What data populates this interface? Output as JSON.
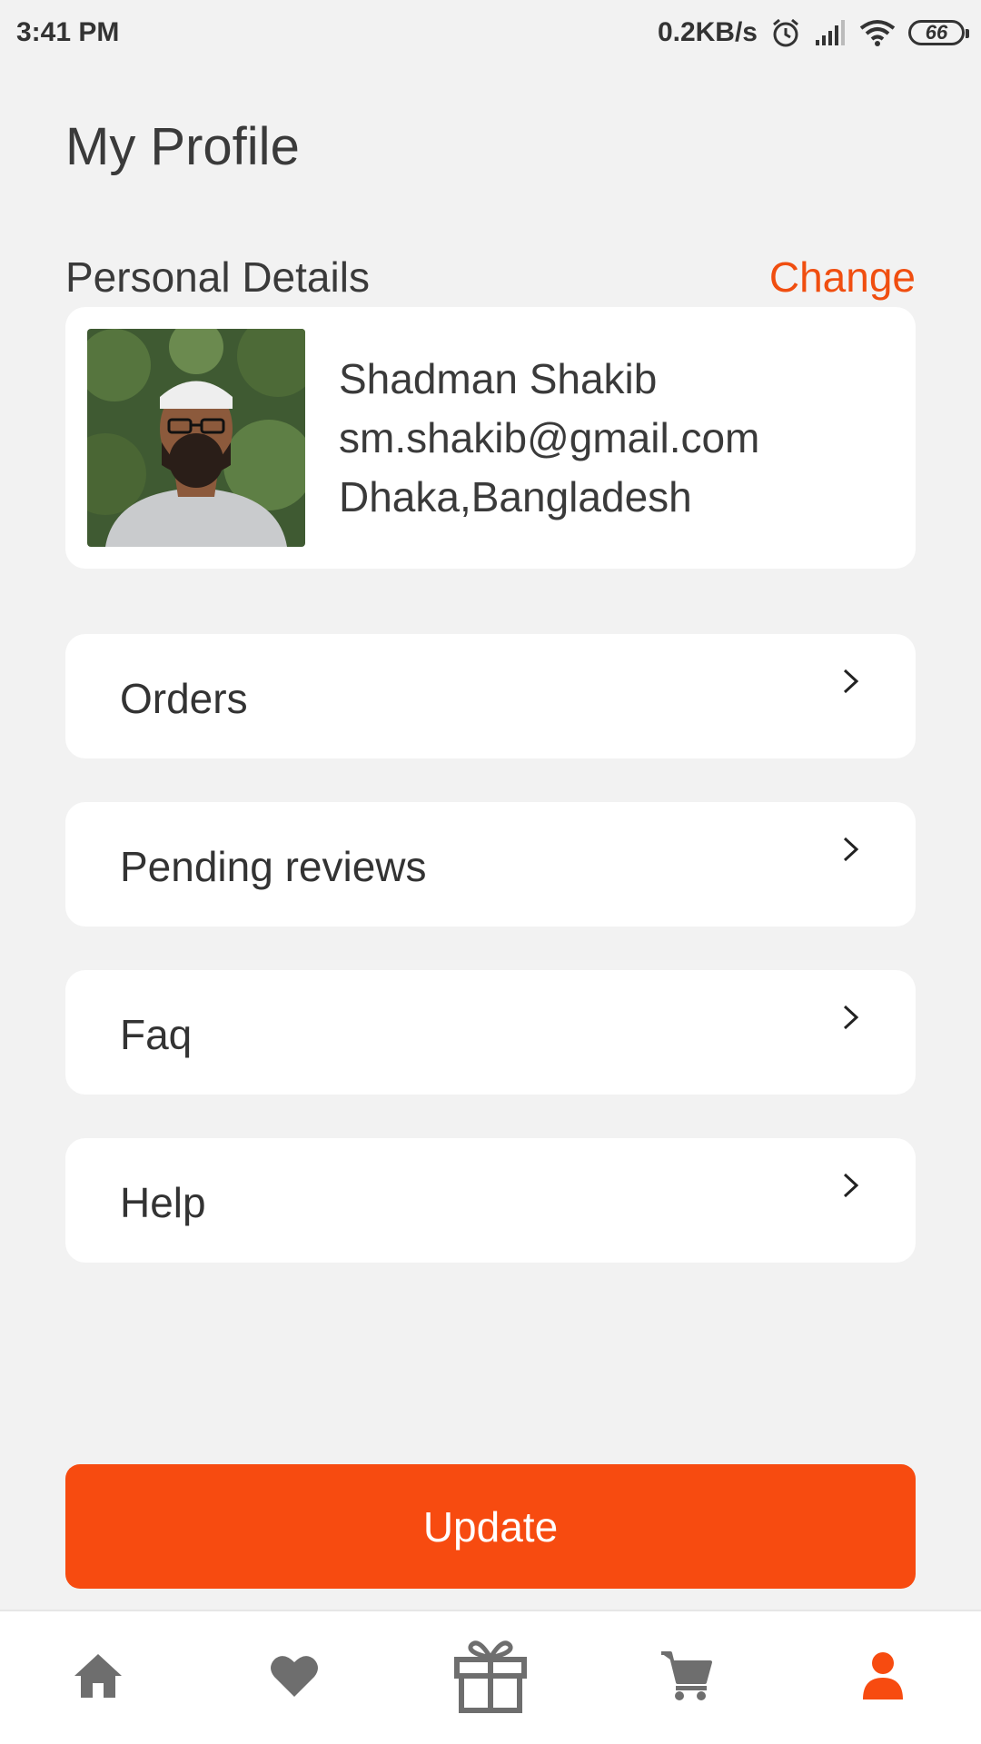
{
  "status_bar": {
    "time": "3:41 PM",
    "network_speed": "0.2KB/s",
    "battery_level": "66",
    "icons": [
      "alarm-icon",
      "signal-icon",
      "wifi-icon",
      "battery-icon"
    ]
  },
  "page": {
    "title": "My Profile"
  },
  "personal_details": {
    "section_label": "Personal Details",
    "change_label": "Change",
    "name": "Shadman Shakib",
    "email": "sm.shakib@gmail.com",
    "location": "Dhaka,Bangladesh"
  },
  "menu": {
    "items": [
      {
        "label": "Orders",
        "icon": "chevron-right-icon"
      },
      {
        "label": "Pending reviews",
        "icon": "chevron-right-icon"
      },
      {
        "label": "Faq",
        "icon": "chevron-right-icon"
      },
      {
        "label": "Help",
        "icon": "chevron-right-icon"
      }
    ]
  },
  "update_button": {
    "label": "Update"
  },
  "bottom_nav": {
    "items": [
      {
        "icon": "home-icon",
        "active": false
      },
      {
        "icon": "heart-icon",
        "active": false
      },
      {
        "icon": "gift-icon",
        "active": false
      },
      {
        "icon": "cart-icon",
        "active": false
      },
      {
        "icon": "person-icon",
        "active": true
      }
    ]
  },
  "colors": {
    "accent": "#f74b10",
    "inactive_icon": "#6e6e6e",
    "background": "#f2f2f2",
    "card": "#ffffff"
  }
}
